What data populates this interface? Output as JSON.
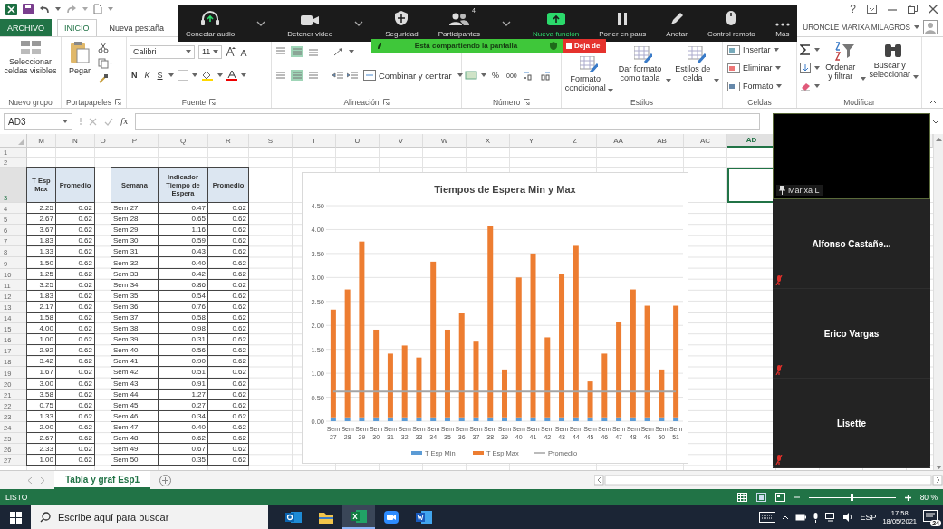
{
  "title_bar": {
    "help_label": "?"
  },
  "ribbon_tabs": [
    {
      "label": "ARCHIVO",
      "kind": "file",
      "selected": false
    },
    {
      "label": "INICIO",
      "kind": "tab",
      "selected": true
    },
    {
      "label": "Nueva pestaña",
      "kind": "tab",
      "selected": false
    }
  ],
  "account": {
    "user": "URONCLE MARIXA MILAGROS"
  },
  "ribbon": {
    "groups": [
      {
        "kind": "custom",
        "label": "Nuevo grupo",
        "buttons": [
          "Seleccionar celdas visibles"
        ]
      },
      {
        "kind": "clipboard",
        "label": "Portapapeles",
        "buttons": [
          "Pegar"
        ]
      },
      {
        "kind": "font",
        "label": "Fuente",
        "font": "Calibri",
        "size": "11",
        "buttons": [
          "N",
          "K",
          "S"
        ]
      },
      {
        "kind": "alignment",
        "label": "Alineación",
        "buttons": [
          "Combinar y centrar"
        ]
      },
      {
        "kind": "number",
        "label": "Número",
        "buttons": [
          "%",
          "000"
        ]
      },
      {
        "kind": "styles",
        "label": "Estilos",
        "buttons": [
          "Formato condicional",
          "Dar formato como tabla",
          "Estilos de celda"
        ]
      },
      {
        "kind": "cells",
        "label": "Celdas",
        "buttons": [
          "Insertar",
          "Eliminar",
          "Formato"
        ]
      },
      {
        "kind": "editing",
        "label": "Modificar",
        "buttons": [
          "Ordenar y filtrar",
          "Buscar y seleccionar"
        ]
      }
    ]
  },
  "formula_bar": {
    "name_box": "AD3",
    "function_label": "fx"
  },
  "sheet": {
    "columns": [
      {
        "label": "M",
        "selected": false
      },
      {
        "label": "N",
        "selected": false
      },
      {
        "label": "O",
        "selected": false
      },
      {
        "label": "P",
        "selected": false
      },
      {
        "label": "Q",
        "selected": false
      },
      {
        "label": "R",
        "selected": false
      },
      {
        "label": "S",
        "selected": false
      },
      {
        "label": "T",
        "selected": false
      },
      {
        "label": "U",
        "selected": false
      },
      {
        "label": "V",
        "selected": false
      },
      {
        "label": "W",
        "selected": false
      },
      {
        "label": "X",
        "selected": false
      },
      {
        "label": "Y",
        "selected": false
      },
      {
        "label": "Z",
        "selected": false
      },
      {
        "label": "AA",
        "selected": false
      },
      {
        "label": "AB",
        "selected": false
      },
      {
        "label": "AC",
        "selected": false
      },
      {
        "label": "AD",
        "selected": true
      }
    ],
    "rows": [
      {
        "number": "1",
        "kind": "blank",
        "selected": false
      },
      {
        "number": "2",
        "kind": "blank",
        "selected": false
      },
      {
        "number": "3",
        "kind": "header",
        "selected": true,
        "cells": [
          "T Esp Max",
          "Promedio",
          "Semana",
          "Indicador Tiempo de Espera",
          "Promedio"
        ]
      },
      {
        "number": "4",
        "kind": "data",
        "selected": false,
        "cells": [
          "2.25",
          "0.62",
          "Sem 27",
          "0.47",
          "0.62"
        ]
      },
      {
        "number": "5",
        "kind": "data",
        "selected": false,
        "cells": [
          "2.67",
          "0.62",
          "Sem 28",
          "0.65",
          "0.62"
        ]
      },
      {
        "number": "6",
        "kind": "data",
        "selected": false,
        "cells": [
          "3.67",
          "0.62",
          "Sem 29",
          "1.16",
          "0.62"
        ]
      },
      {
        "number": "7",
        "kind": "data",
        "selected": false,
        "cells": [
          "1.83",
          "0.62",
          "Sem 30",
          "0.59",
          "0.62"
        ]
      },
      {
        "number": "8",
        "kind": "data",
        "selected": false,
        "cells": [
          "1.33",
          "0.62",
          "Sem 31",
          "0.43",
          "0.62"
        ]
      },
      {
        "number": "9",
        "kind": "data",
        "selected": false,
        "cells": [
          "1.50",
          "0.62",
          "Sem 32",
          "0.40",
          "0.62"
        ]
      },
      {
        "number": "10",
        "kind": "data",
        "selected": false,
        "cells": [
          "1.25",
          "0.62",
          "Sem 33",
          "0.42",
          "0.62"
        ]
      },
      {
        "number": "11",
        "kind": "data",
        "selected": false,
        "cells": [
          "3.25",
          "0.62",
          "Sem 34",
          "0.86",
          "0.62"
        ]
      },
      {
        "number": "12",
        "kind": "data",
        "selected": false,
        "cells": [
          "1.83",
          "0.62",
          "Sem 35",
          "0.54",
          "0.62"
        ]
      },
      {
        "number": "13",
        "kind": "data",
        "selected": false,
        "cells": [
          "2.17",
          "0.62",
          "Sem 36",
          "0.76",
          "0.62"
        ]
      },
      {
        "number": "14",
        "kind": "data",
        "selected": false,
        "cells": [
          "1.58",
          "0.62",
          "Sem 37",
          "0.58",
          "0.62"
        ]
      },
      {
        "number": "15",
        "kind": "data",
        "selected": false,
        "cells": [
          "4.00",
          "0.62",
          "Sem 38",
          "0.98",
          "0.62"
        ]
      },
      {
        "number": "16",
        "kind": "data",
        "selected": false,
        "cells": [
          "1.00",
          "0.62",
          "Sem 39",
          "0.31",
          "0.62"
        ]
      },
      {
        "number": "17",
        "kind": "data",
        "selected": false,
        "cells": [
          "2.92",
          "0.62",
          "Sem 40",
          "0.56",
          "0.62"
        ]
      },
      {
        "number": "18",
        "kind": "data",
        "selected": false,
        "cells": [
          "3.42",
          "0.62",
          "Sem 41",
          "0.90",
          "0.62"
        ]
      },
      {
        "number": "19",
        "kind": "data",
        "selected": false,
        "cells": [
          "1.67",
          "0.62",
          "Sem 42",
          "0.51",
          "0.62"
        ]
      },
      {
        "number": "20",
        "kind": "data",
        "selected": false,
        "cells": [
          "3.00",
          "0.62",
          "Sem 43",
          "0.91",
          "0.62"
        ]
      },
      {
        "number": "21",
        "kind": "data",
        "selected": false,
        "cells": [
          "3.58",
          "0.62",
          "Sem 44",
          "1.27",
          "0.62"
        ]
      },
      {
        "number": "22",
        "kind": "data",
        "selected": false,
        "cells": [
          "0.75",
          "0.62",
          "Sem 45",
          "0.27",
          "0.62"
        ]
      },
      {
        "number": "23",
        "kind": "data",
        "selected": false,
        "cells": [
          "1.33",
          "0.62",
          "Sem 46",
          "0.34",
          "0.62"
        ]
      },
      {
        "number": "24",
        "kind": "data",
        "selected": false,
        "cells": [
          "2.00",
          "0.62",
          "Sem 47",
          "0.40",
          "0.62"
        ]
      },
      {
        "number": "25",
        "kind": "data",
        "selected": false,
        "cells": [
          "2.67",
          "0.62",
          "Sem 48",
          "0.62",
          "0.62"
        ]
      },
      {
        "number": "26",
        "kind": "data",
        "selected": false,
        "cells": [
          "2.33",
          "0.62",
          "Sem 49",
          "0.67",
          "0.62"
        ]
      },
      {
        "number": "27",
        "kind": "data",
        "selected": false,
        "cells": [
          "1.00",
          "0.62",
          "Sem 50",
          "0.35",
          "0.62"
        ]
      }
    ],
    "chart_data": {
      "type": "bar",
      "title": "Tiempos de Espera Min y Max",
      "stacked": true,
      "grid": true,
      "legend": "bottom",
      "categories": [
        "Sem 27",
        "Sem 28",
        "Sem 29",
        "Sem 30",
        "Sem 31",
        "Sem 32",
        "Sem 33",
        "Sem 34",
        "Sem 35",
        "Sem 36",
        "Sem 37",
        "Sem 38",
        "Sem 39",
        "Sem 40",
        "Sem 41",
        "Sem 42",
        "Sem 43",
        "Sem 44",
        "Sem 45",
        "Sem 46",
        "Sem 47",
        "Sem 48",
        "Sem 49",
        "Sem 50",
        "Sem 51"
      ],
      "series": [
        {
          "name": "T Esp Min",
          "color": "#5b9bd5",
          "values": [
            0.08,
            0.08,
            0.08,
            0.08,
            0.08,
            0.08,
            0.08,
            0.08,
            0.08,
            0.08,
            0.08,
            0.08,
            0.08,
            0.08,
            0.08,
            0.08,
            0.08,
            0.08,
            0.08,
            0.08,
            0.08,
            0.08,
            0.08,
            0.08,
            0.08
          ]
        },
        {
          "name": "T Esp Max",
          "color": "#ed7d31",
          "values": [
            2.25,
            2.67,
            3.67,
            1.83,
            1.33,
            1.5,
            1.25,
            3.25,
            1.83,
            2.17,
            1.58,
            4.0,
            1.0,
            2.92,
            3.42,
            1.67,
            3.0,
            3.58,
            0.75,
            1.33,
            2.0,
            2.67,
            2.33,
            1.0,
            2.33
          ]
        },
        {
          "name": "Promedio",
          "type": "line",
          "color": "#a5a5a5",
          "values": [
            0.62,
            0.62,
            0.62,
            0.62,
            0.62,
            0.62,
            0.62,
            0.62,
            0.62,
            0.62,
            0.62,
            0.62,
            0.62,
            0.62,
            0.62,
            0.62,
            0.62,
            0.62,
            0.62,
            0.62,
            0.62,
            0.62,
            0.62,
            0.62,
            0.62
          ]
        }
      ],
      "ylim": [
        0,
        4.5
      ],
      "yticks": [
        {
          "value": 0,
          "label": "0.00"
        },
        {
          "value": 0.5,
          "label": "0.50"
        },
        {
          "value": 1,
          "label": "1.00"
        },
        {
          "value": 1.5,
          "label": "1.50"
        },
        {
          "value": 2,
          "label": "2.00"
        },
        {
          "value": 2.5,
          "label": "2.50"
        },
        {
          "value": 3,
          "label": "3.00"
        },
        {
          "value": 3.5,
          "label": "3.50"
        },
        {
          "value": 4,
          "label": "4.00"
        },
        {
          "value": 4.5,
          "label": "4.50"
        }
      ]
    }
  },
  "sheet_tabs": [
    {
      "label": "Tabla y graf Esp1",
      "selected": true
    }
  ],
  "status_bar": {
    "status": "LISTO",
    "zoom": "80 %",
    "zoom_level": {
      "level": 0.5
    }
  },
  "taskbar": {
    "search_placeholder": "Escribe aquí para buscar",
    "apps": [
      {
        "kind": "mail",
        "active": false
      },
      {
        "kind": "folder",
        "active": false
      },
      {
        "kind": "sheet",
        "active": true
      },
      {
        "kind": "video",
        "active": false
      },
      {
        "kind": "doc",
        "active": false
      }
    ],
    "language": "ESP",
    "time": "17:58",
    "date": "18/05/2021",
    "notifications": "24"
  },
  "meeting_toolbar": {
    "items": [
      {
        "label": "Conectar audio",
        "kind": "audio",
        "menu": true
      },
      {
        "label": "Detener video",
        "kind": "video",
        "menu": true
      },
      {
        "label": "Seguridad",
        "kind": "security",
        "menu": false
      },
      {
        "label": "Participantes",
        "kind": "participants",
        "count": "4",
        "menu": true
      },
      {
        "label": "Nueva función",
        "kind": "share",
        "menu": false
      },
      {
        "label": "Poner en paus",
        "kind": "pause",
        "menu": false
      },
      {
        "label": "Anotar",
        "kind": "annotate",
        "menu": false
      },
      {
        "label": "Control remoto",
        "kind": "remote",
        "menu": false
      },
      {
        "label": "Más",
        "kind": "more",
        "menu": false
      }
    ]
  },
  "share_banner": {
    "text": "Está compartiendo la pantalla",
    "stop_label": "Deja de"
  },
  "participants": [
    {
      "name": "Marixa L",
      "kind": "video",
      "pinned": true,
      "muted": false
    },
    {
      "name": "Alfonso Castañe...",
      "kind": "tile",
      "pinned": false,
      "muted": true
    },
    {
      "name": "Erico Vargas",
      "kind": "tile",
      "pinned": false,
      "muted": true
    },
    {
      "name": "Lisette",
      "kind": "tile",
      "pinned": false,
      "muted": true
    }
  ]
}
